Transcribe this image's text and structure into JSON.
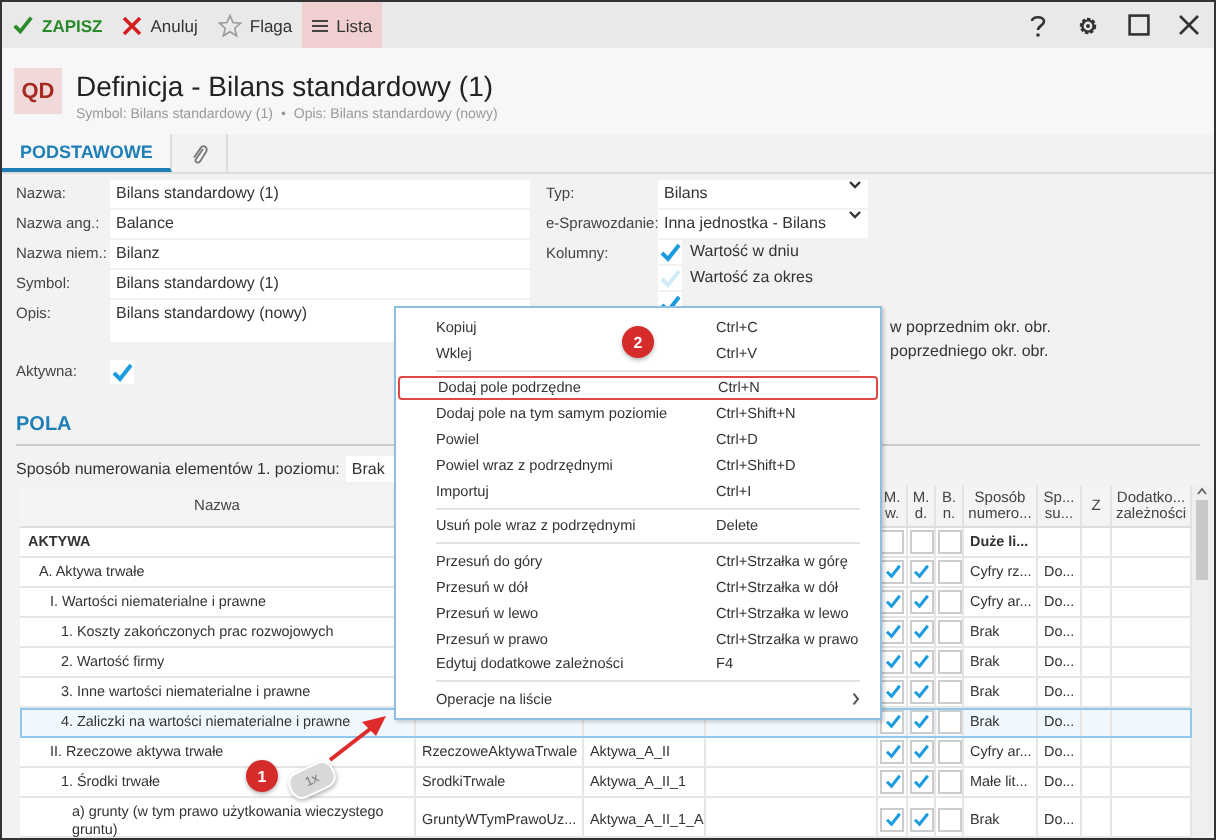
{
  "toolbar": {
    "buttons": [
      {
        "label": "ZAPISZ",
        "kind": "save",
        "selected": false
      },
      {
        "label": "Anuluj",
        "kind": "cancel",
        "selected": false
      },
      {
        "label": "Flaga",
        "kind": "flag",
        "selected": false
      },
      {
        "label": "Lista",
        "kind": "list",
        "selected": true
      }
    ]
  },
  "header": {
    "badge": "QD",
    "title": "Definicja - Bilans standardowy (1)",
    "subtitle": [
      "Symbol: Bilans standardowy (1)",
      "•",
      "Opis: Bilans standardowy (nowy)"
    ]
  },
  "tabs": [
    {
      "label": "PODSTAWOWE",
      "kind": "text",
      "selected": true
    },
    {
      "kind": "attachment",
      "selected": false
    }
  ],
  "form": {
    "left": [
      {
        "label": "Nazwa:",
        "kind": "text",
        "value": "Bilans standardowy (1)"
      },
      {
        "label": "Nazwa ang.:",
        "kind": "text",
        "value": "Balance"
      },
      {
        "label": "Nazwa niem.:",
        "kind": "text",
        "value": "Bilanz"
      },
      {
        "label": "Symbol:",
        "kind": "text",
        "value": "Bilans standardowy (1)"
      },
      {
        "label": "Opis:",
        "kind": "textarea",
        "value": "Bilans standardowy (nowy)"
      },
      {
        "label": "Aktywna:",
        "kind": "checkbox",
        "checked": true
      }
    ],
    "right": [
      {
        "label": "Typ:",
        "kind": "select",
        "value": "Bilans"
      },
      {
        "label": "e-Sprawozdanie:",
        "kind": "select",
        "value": "Inna jednostka - Bilans"
      },
      {
        "label": "Kolumny:",
        "kind": "checklist",
        "items": [
          {
            "label": "Wartość w dniu",
            "checked": true
          },
          {
            "label": "Wartość za okres",
            "checked": false
          },
          {
            "checked": true
          },
          {
            "label": "w poprzednim okr. obr."
          },
          {
            "label": "poprzedniego okr. obr."
          }
        ]
      }
    ]
  },
  "section": {
    "title": "POLA",
    "numbering_label": "Sposób numerowania elementów 1. poziomu:",
    "numbering_value": "Brak"
  },
  "table": {
    "columns": [
      {
        "label": "Nazwa"
      },
      {},
      {},
      {},
      {
        "label": "M. w."
      },
      {
        "label": "M. d."
      },
      {
        "label": "B. n."
      },
      {
        "label": "Sposób numero..."
      },
      {
        "label": "Sp... su..."
      },
      {
        "label": "Z"
      },
      {
        "label": "Dodatko... zależności"
      }
    ],
    "rows": [
      {
        "name": "AKTYWA",
        "kind": "group",
        "selected": false,
        "checks": [
          false,
          false,
          false
        ],
        "numbering": "Duże li...",
        "children": [
          {
            "name": "A. Aktywa trwałe",
            "kind": "item",
            "selected": false,
            "checks": [
              true,
              true,
              false
            ],
            "numbering": "Cyfry rz...",
            "column_9": "Do...",
            "children": [
              {
                "name": "I. Wartości niematerialne i prawne",
                "kind": "item",
                "selected": false,
                "checks": [
                  true,
                  true,
                  false
                ],
                "numbering": "Cyfry ar...",
                "column_9": "Do...",
                "children": [
                  {
                    "name": "1. Koszty zakończonych prac rozwojowych",
                    "kind": "item",
                    "selected": false,
                    "checks": [
                      true,
                      true,
                      false
                    ],
                    "numbering": "Brak",
                    "column_9": "Do..."
                  },
                  {
                    "name": "2. Wartość firmy",
                    "kind": "item",
                    "selected": false,
                    "checks": [
                      true,
                      true,
                      false
                    ],
                    "numbering": "Brak",
                    "column_9": "Do..."
                  },
                  {
                    "name": "3. Inne wartości niematerialne i prawne",
                    "kind": "item",
                    "selected": false,
                    "checks": [
                      true,
                      true,
                      false
                    ],
                    "numbering": "Brak",
                    "column_9": "Do..."
                  },
                  {
                    "name": "4. Zaliczki na wartości niematerialne i prawne",
                    "kind": "item",
                    "selected": true,
                    "checks": [
                      true,
                      true,
                      false
                    ],
                    "numbering": "Brak",
                    "column_9": "Do..."
                  }
                ]
              },
              {
                "name": "II. Rzeczowe aktywa trwałe",
                "kind": "item",
                "selected": false,
                "column_2": "RzeczoweAktywaTrwale",
                "column_3": "Aktywa_A_II",
                "checks": [
                  true,
                  true,
                  false
                ],
                "numbering": "Cyfry ar...",
                "column_9": "Do...",
                "children": [
                  {
                    "name": "1. Środki trwałe",
                    "kind": "item",
                    "selected": false,
                    "column_2": "SrodkiTrwale",
                    "column_3": "Aktywa_A_II_1",
                    "checks": [
                      true,
                      true,
                      false
                    ],
                    "numbering": "Małe lit...",
                    "column_9": "Do...",
                    "children": [
                      {
                        "name": "a) grunty (w tym prawo użytkowania wieczystego gruntu)",
                        "kind": "item",
                        "selected": false,
                        "column_2": "GruntyWTymPrawoUz...",
                        "column_3": "Aktywa_A_II_1_A",
                        "checks": [
                          true,
                          true,
                          false
                        ],
                        "numbering": "Brak",
                        "column_9": "Do..."
                      }
                    ]
                  }
                ]
              }
            ]
          }
        ]
      }
    ]
  },
  "context_menu": {
    "items": [
      {
        "kind": "item",
        "label": "Kopiuj",
        "shortcut": "Ctrl+C",
        "highlighted": false
      },
      {
        "kind": "item",
        "label": "Wklej",
        "shortcut": "Ctrl+V",
        "highlighted": false
      },
      {
        "kind": "separator"
      },
      {
        "kind": "item",
        "label": "Dodaj pole podrzędne",
        "shortcut": "Ctrl+N",
        "highlighted": true
      },
      {
        "kind": "item",
        "label": "Dodaj pole na tym samym poziomie",
        "shortcut": "Ctrl+Shift+N",
        "highlighted": false
      },
      {
        "kind": "item",
        "label": "Powiel",
        "shortcut": "Ctrl+D",
        "highlighted": false
      },
      {
        "kind": "item",
        "label": "Powiel wraz z podrzędnymi",
        "shortcut": "Ctrl+Shift+D",
        "highlighted": false
      },
      {
        "kind": "item",
        "label": "Importuj",
        "shortcut": "Ctrl+I",
        "highlighted": false
      },
      {
        "kind": "separator"
      },
      {
        "kind": "item",
        "label": "Usuń pole wraz z podrzędnymi",
        "shortcut": "Delete",
        "highlighted": false
      },
      {
        "kind": "separator"
      },
      {
        "kind": "item",
        "label": "Przesuń do góry",
        "shortcut": "Ctrl+Strzałka w górę",
        "highlighted": false
      },
      {
        "kind": "item",
        "label": "Przesuń w dół",
        "shortcut": "Ctrl+Strzałka w dół",
        "highlighted": false
      },
      {
        "kind": "item",
        "label": "Przesuń w lewo",
        "shortcut": "Ctrl+Strzałka w lewo",
        "highlighted": false
      },
      {
        "kind": "item",
        "label": "Przesuń w prawo",
        "shortcut": "Ctrl+Strzałka w prawo",
        "highlighted": false
      },
      {
        "kind": "item",
        "label": "Edytuj dodatkowe zależności",
        "shortcut": "F4",
        "highlighted": false
      },
      {
        "kind": "separator"
      },
      {
        "kind": "submenu",
        "label": "Operacje na liście",
        "highlighted": false
      }
    ]
  },
  "annotations": {
    "steps": [
      {
        "label": "1",
        "kind": "click"
      },
      {
        "label": "2",
        "kind": "menu"
      }
    ],
    "click_count": "1x"
  }
}
